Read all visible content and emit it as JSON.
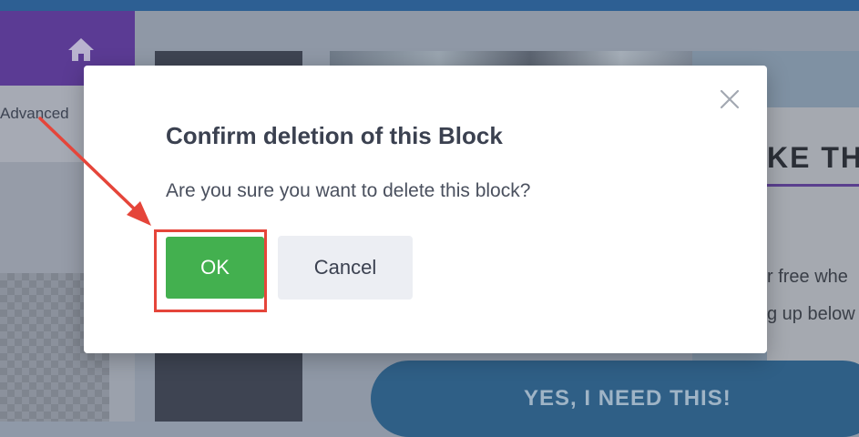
{
  "sidebar": {
    "home_icon": "home-icon",
    "tab_label": "Advanced"
  },
  "canvas": {
    "headline_fragment": "KE TH",
    "body_line1_fragment": "r free whe",
    "body_line2_fragment": "g up below",
    "cta_label": "YES, I NEED THIS!"
  },
  "modal": {
    "title": "Confirm deletion of this Block",
    "message": "Are you sure you want to delete this block?",
    "ok_label": "OK",
    "cancel_label": "Cancel",
    "close_icon": "close-icon"
  },
  "colors": {
    "ok_green": "#43b04f",
    "annotation_red": "#e5453a",
    "sidebar_purple": "#5b3b94",
    "cta_blue": "#2f5f86"
  }
}
